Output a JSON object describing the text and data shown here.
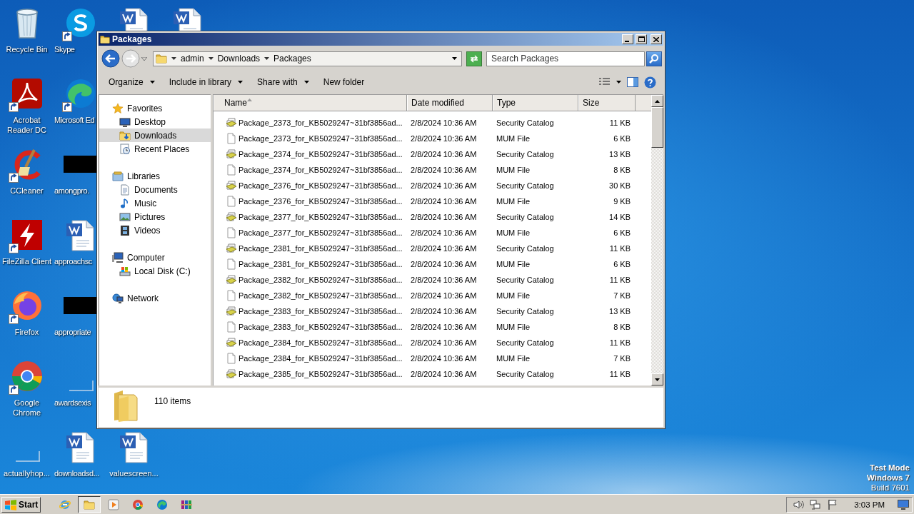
{
  "desktop": {
    "columns": [
      {
        "icons": [
          {
            "label": "Recycle Bin",
            "kind": "recycle",
            "shortcut": false
          },
          {
            "label": "Acrobat Reader DC",
            "kind": "acrobat",
            "shortcut": true
          },
          {
            "label": "CCleaner",
            "kind": "ccleaner",
            "shortcut": true
          },
          {
            "label": "FileZilla Client",
            "kind": "filezilla",
            "shortcut": true
          },
          {
            "label": "Firefox",
            "kind": "firefox",
            "shortcut": true
          },
          {
            "label": "Google Chrome",
            "kind": "chrome",
            "shortcut": true
          },
          {
            "label": "actuallyhop...",
            "kind": "blank",
            "shortcut": false
          }
        ]
      },
      {
        "icons": [
          {
            "label": "Skype",
            "kind": "skype",
            "shortcut": true
          },
          {
            "label": "Microsoft Ed",
            "kind": "edge",
            "shortcut": true
          },
          {
            "label": "amongpro.",
            "kind": "thumb",
            "shortcut": false
          },
          {
            "label": "approachsc",
            "kind": "word",
            "shortcut": false
          },
          {
            "label": "appropriate",
            "kind": "thumb",
            "shortcut": false
          },
          {
            "label": "awardsexis",
            "kind": "blank",
            "shortcut": false
          },
          {
            "label": "downloadsd...",
            "kind": "word",
            "shortcut": false
          }
        ]
      },
      {
        "icons": [
          {
            "kind": "word",
            "shortcut": false
          },
          {
            "label": "valuescreen...",
            "kind": "word",
            "shortcut": false
          }
        ]
      },
      {
        "icons": [
          {
            "kind": "word",
            "shortcut": false
          }
        ]
      }
    ],
    "system_watermark": [
      "Test Mode",
      "Windows 7",
      "Build 7601"
    ]
  },
  "window": {
    "title": "Packages",
    "address": {
      "crumbs": [
        "admin",
        "Downloads",
        "Packages"
      ]
    },
    "search": {
      "placeholder": "Search Packages"
    },
    "toolbar": [
      {
        "label": "Organize",
        "dropdown": true
      },
      {
        "label": "Include in library",
        "dropdown": true
      },
      {
        "label": "Share with",
        "dropdown": true
      },
      {
        "label": "New folder",
        "dropdown": false
      }
    ],
    "nav_pane": [
      {
        "label": "Favorites",
        "kind": "star",
        "selected": false,
        "children": [
          {
            "label": "Desktop",
            "kind": "desktop",
            "selected": false
          },
          {
            "label": "Downloads",
            "kind": "downloads",
            "selected": true
          },
          {
            "label": "Recent Places",
            "kind": "recent",
            "selected": false
          }
        ]
      },
      {
        "label": "Libraries",
        "kind": "libraries",
        "selected": false,
        "children": [
          {
            "label": "Documents",
            "kind": "documents",
            "selected": false
          },
          {
            "label": "Music",
            "kind": "music",
            "selected": false
          },
          {
            "label": "Pictures",
            "kind": "pictures",
            "selected": false
          },
          {
            "label": "Videos",
            "kind": "videos",
            "selected": false
          }
        ]
      },
      {
        "label": "Computer",
        "kind": "computer",
        "selected": false,
        "children": [
          {
            "label": "Local Disk (C:)",
            "kind": "disk",
            "selected": false
          }
        ]
      },
      {
        "label": "Network",
        "kind": "network",
        "selected": false
      }
    ],
    "columns": [
      {
        "label": "Name",
        "sorted": true
      },
      {
        "label": "Date modified",
        "sorted": false
      },
      {
        "label": "Type",
        "sorted": false
      },
      {
        "label": "Size",
        "sorted": false
      }
    ],
    "rows": [
      {
        "kind": "catalog",
        "name": "Package_2373_for_KB5029247~31bf3856ad...",
        "date": "2/8/2024 10:36 AM",
        "type": "Security Catalog",
        "size": "11 KB"
      },
      {
        "kind": "file",
        "name": "Package_2373_for_KB5029247~31bf3856ad...",
        "date": "2/8/2024 10:36 AM",
        "type": "MUM File",
        "size": "6 KB"
      },
      {
        "kind": "catalog",
        "name": "Package_2374_for_KB5029247~31bf3856ad...",
        "date": "2/8/2024 10:36 AM",
        "type": "Security Catalog",
        "size": "13 KB"
      },
      {
        "kind": "file",
        "name": "Package_2374_for_KB5029247~31bf3856ad...",
        "date": "2/8/2024 10:36 AM",
        "type": "MUM File",
        "size": "8 KB"
      },
      {
        "kind": "catalog",
        "name": "Package_2376_for_KB5029247~31bf3856ad...",
        "date": "2/8/2024 10:36 AM",
        "type": "Security Catalog",
        "size": "30 KB"
      },
      {
        "kind": "file",
        "name": "Package_2376_for_KB5029247~31bf3856ad...",
        "date": "2/8/2024 10:36 AM",
        "type": "MUM File",
        "size": "9 KB"
      },
      {
        "kind": "catalog",
        "name": "Package_2377_for_KB5029247~31bf3856ad...",
        "date": "2/8/2024 10:36 AM",
        "type": "Security Catalog",
        "size": "14 KB"
      },
      {
        "kind": "file",
        "name": "Package_2377_for_KB5029247~31bf3856ad...",
        "date": "2/8/2024 10:36 AM",
        "type": "MUM File",
        "size": "6 KB"
      },
      {
        "kind": "catalog",
        "name": "Package_2381_for_KB5029247~31bf3856ad...",
        "date": "2/8/2024 10:36 AM",
        "type": "Security Catalog",
        "size": "11 KB"
      },
      {
        "kind": "file",
        "name": "Package_2381_for_KB5029247~31bf3856ad...",
        "date": "2/8/2024 10:36 AM",
        "type": "MUM File",
        "size": "6 KB"
      },
      {
        "kind": "catalog",
        "name": "Package_2382_for_KB5029247~31bf3856ad...",
        "date": "2/8/2024 10:36 AM",
        "type": "Security Catalog",
        "size": "11 KB"
      },
      {
        "kind": "file",
        "name": "Package_2382_for_KB5029247~31bf3856ad...",
        "date": "2/8/2024 10:36 AM",
        "type": "MUM File",
        "size": "7 KB"
      },
      {
        "kind": "catalog",
        "name": "Package_2383_for_KB5029247~31bf3856ad...",
        "date": "2/8/2024 10:36 AM",
        "type": "Security Catalog",
        "size": "13 KB"
      },
      {
        "kind": "file",
        "name": "Package_2383_for_KB5029247~31bf3856ad...",
        "date": "2/8/2024 10:36 AM",
        "type": "MUM File",
        "size": "8 KB"
      },
      {
        "kind": "catalog",
        "name": "Package_2384_for_KB5029247~31bf3856ad...",
        "date": "2/8/2024 10:36 AM",
        "type": "Security Catalog",
        "size": "11 KB"
      },
      {
        "kind": "file",
        "name": "Package_2384_for_KB5029247~31bf3856ad...",
        "date": "2/8/2024 10:36 AM",
        "type": "MUM File",
        "size": "7 KB"
      },
      {
        "kind": "catalog",
        "name": "Package_2385_for_KB5029247~31bf3856ad...",
        "date": "2/8/2024 10:36 AM",
        "type": "Security Catalog",
        "size": "11 KB"
      }
    ],
    "status": {
      "count": "110 items"
    }
  },
  "taskbar": {
    "start": "Start",
    "apps": [
      {
        "kind": "ie",
        "selected": false
      },
      {
        "kind": "explorer",
        "selected": true
      },
      {
        "kind": "media",
        "selected": false
      },
      {
        "kind": "chrome",
        "selected": false
      },
      {
        "kind": "edge",
        "selected": false
      },
      {
        "kind": "winrar",
        "selected": false
      }
    ],
    "clock": "3:03 PM"
  }
}
